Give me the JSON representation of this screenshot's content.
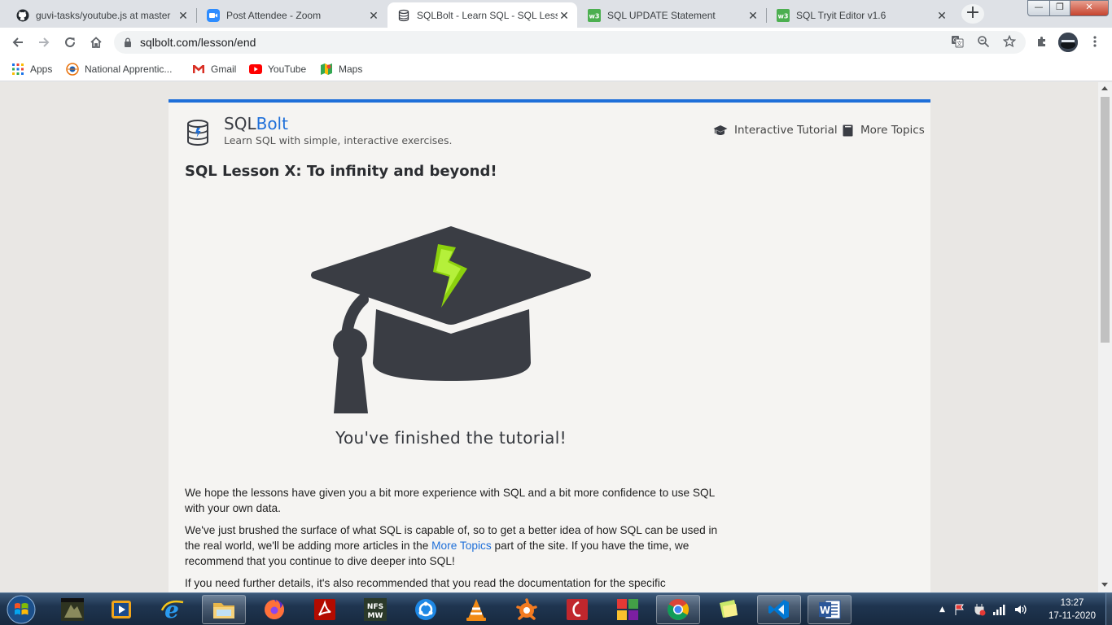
{
  "browser": {
    "tabs": [
      {
        "title": "guvi-tasks/youtube.js at master",
        "icon": "github-icon"
      },
      {
        "title": "Post Attendee - Zoom",
        "icon": "zoom-icon"
      },
      {
        "title": "SQLBolt - Learn SQL - SQL Lesson",
        "icon": "sqlbolt-icon"
      },
      {
        "title": "SQL UPDATE Statement",
        "icon": "w3schools-icon"
      },
      {
        "title": "SQL Tryit Editor v1.6",
        "icon": "w3schools-icon"
      }
    ],
    "new_tab_label": "+",
    "url": "sqlbolt.com/lesson/end",
    "bookmarks": [
      {
        "label": "Apps",
        "icon": "apps-grid-icon"
      },
      {
        "label": "National Apprentic...",
        "icon": "apprenticeship-icon"
      },
      {
        "label": "Gmail",
        "icon": "gmail-icon"
      },
      {
        "label": "YouTube",
        "icon": "youtube-icon"
      },
      {
        "label": "Maps",
        "icon": "maps-icon"
      }
    ]
  },
  "site": {
    "brand_prefix": "SQL",
    "brand_accent": "Bolt",
    "tagline": "Learn SQL with simple, interactive exercises.",
    "nav": {
      "tutorial": "Interactive Tutorial",
      "topics": "More Topics"
    },
    "accent_color": "#1e6fd9"
  },
  "lesson": {
    "title": "SQL Lesson X: To infinity and beyond!",
    "finished": "You've finished the tutorial!",
    "p1": "We hope the lessons have given you a bit more experience with SQL and a bit more confidence to use SQL with your own data.",
    "p2_before": "We've just brushed the surface of what SQL is capable of, so to get a better idea of how SQL can be used in the real world, we'll be adding more articles in the ",
    "p2_link": "More Topics",
    "p2_after": " part of the site. If you have the time, we recommend that you continue to dive deeper into SQL!",
    "p3": "If you need further details, it's also recommended that you read the documentation for the specific"
  },
  "taskbar": {
    "time": "13:27",
    "date": "17-11-2020"
  }
}
